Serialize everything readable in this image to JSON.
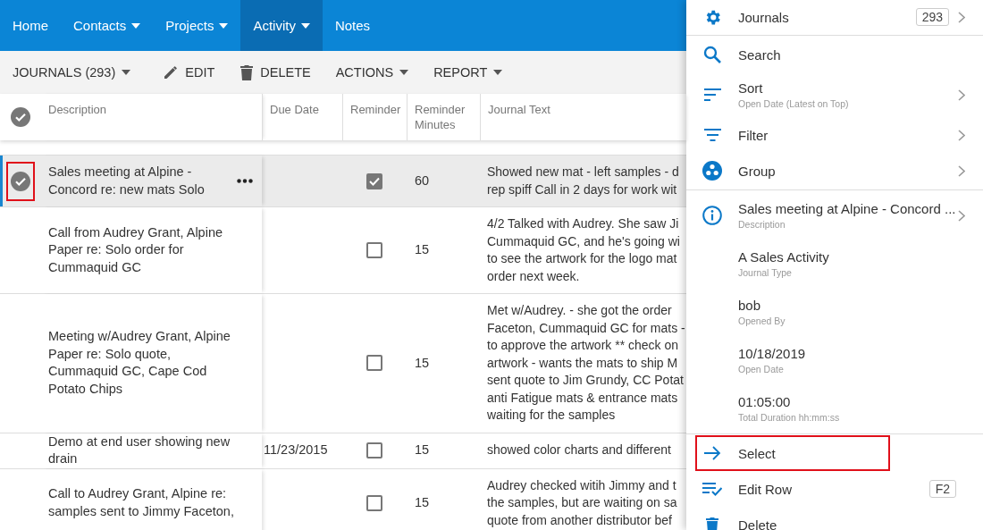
{
  "nav": {
    "items": [
      {
        "label": "Home",
        "dropdown": false,
        "selected": false
      },
      {
        "label": "Contacts",
        "dropdown": true,
        "selected": false
      },
      {
        "label": "Projects",
        "dropdown": true,
        "selected": false
      },
      {
        "label": "Activity",
        "dropdown": true,
        "selected": true
      },
      {
        "label": "Notes",
        "dropdown": false,
        "selected": false
      }
    ]
  },
  "toolbar": {
    "items": [
      {
        "label": "JOURNALS (293)",
        "kind": "menu"
      },
      {
        "label": "EDIT",
        "kind": "edit"
      },
      {
        "label": "DELETE",
        "kind": "delete"
      },
      {
        "label": "ACTIONS",
        "kind": "menu"
      },
      {
        "label": "REPORT",
        "kind": "menu"
      }
    ]
  },
  "grid": {
    "select_all_checked": true,
    "columns": [
      "Description",
      "Due Date",
      "Reminder",
      "Reminder Minutes",
      "Journal Text"
    ],
    "rows": [
      {
        "selected": true,
        "highlighted": true,
        "description": "Sales meeting at Alpine -\nConcord re: new mats Solo",
        "reminder": true,
        "reminder_minutes": "60",
        "journal_text": "Showed new mat - left samples - d\nrep spiff Call in 2 days for work wit"
      },
      {
        "selected": false,
        "highlighted": false,
        "description": "Call from Audrey Grant, Alpine\nPaper re: Solo order for\nCummaquid GC",
        "reminder": false,
        "reminder_minutes": "15",
        "journal_text": "4/2 Talked with Audrey. She saw Ji\nCummaquid GC, and he's going wi\nto see the artwork for the logo mat\norder next week."
      },
      {
        "selected": false,
        "highlighted": false,
        "description": "Meeting w/Audrey Grant, Alpine\nPaper re: Solo quote,\nCummaquid GC, Cape Cod\nPotato Chips",
        "reminder": false,
        "reminder_minutes": "15",
        "journal_text": "Met w/Audrey. - she got the order\nFaceton, Cummaquid GC for mats -\nto approve the artwork ** check on\nartwork - wants the mats to ship M\nsent quote to Jim Grundy, CC Potat\nanti Fatigue mats & entrance mats\nwaiting for the samples"
      },
      {
        "selected": false,
        "highlighted": false,
        "description": "Demo at end user showing new\ndrain",
        "due_date": "11/23/2015",
        "reminder": false,
        "reminder_minutes": "15",
        "journal_text": "showed color charts and different"
      },
      {
        "selected": false,
        "highlighted": false,
        "description": "Call to Audrey Grant, Alpine re:\nsamples sent to Jimmy Faceton,",
        "reminder": false,
        "reminder_minutes": "15",
        "journal_text": "Audrey checked witih Jimmy and t\nthe samples, but are waiting on sa\nquote from another distributor bef"
      }
    ]
  },
  "panel": {
    "title": {
      "label": "Journals",
      "count": "293",
      "has_submenu": true
    },
    "options": [
      {
        "label": "Search",
        "has_submenu": false
      },
      {
        "label": "Sort",
        "detail": "Open Date (Latest on Top)",
        "has_submenu": true
      },
      {
        "label": "Filter",
        "has_submenu": true
      },
      {
        "label": "Group",
        "has_submenu": true
      }
    ],
    "record": [
      {
        "kind": "info",
        "value": "Sales meeting at Alpine - Concord ...",
        "label": "Description",
        "has_submenu": true
      },
      {
        "kind": "field",
        "value": "A Sales Activity",
        "label": "Journal Type",
        "has_submenu": false
      },
      {
        "kind": "field",
        "value": "bob",
        "label": "Opened By",
        "has_submenu": false
      },
      {
        "kind": "field",
        "value": "10/18/2019",
        "label": "Open Date",
        "has_submenu": false
      },
      {
        "kind": "field",
        "value": "01:05:00",
        "label": "Total Duration hh:mm:ss",
        "has_submenu": false
      }
    ],
    "actions": [
      {
        "label": "Select",
        "highlighted": true
      },
      {
        "label": "Edit Row",
        "shortcut": "F2",
        "highlighted": false
      },
      {
        "label": "Delete",
        "highlighted": false
      }
    ]
  }
}
